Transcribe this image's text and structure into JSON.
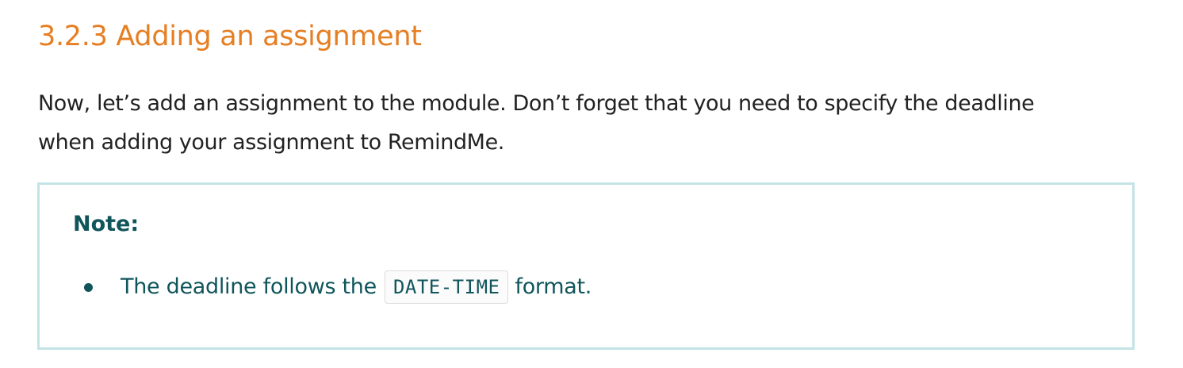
{
  "heading": {
    "text": "3.2.3 Adding an assignment"
  },
  "intro": {
    "line1": "Now, let’s add an assignment to the module. Don’t forget that you need to specify the deadline",
    "line2": "when adding your assignment to RemindMe."
  },
  "note": {
    "title": "Note:",
    "items": [
      {
        "before": "The deadline follows the",
        "code": "DATE-TIME",
        "after": "format."
      }
    ]
  },
  "colors": {
    "heading": "#e67e22",
    "note_text": "#10555b",
    "note_border": "#c4e3e6",
    "body_text": "#222222"
  }
}
